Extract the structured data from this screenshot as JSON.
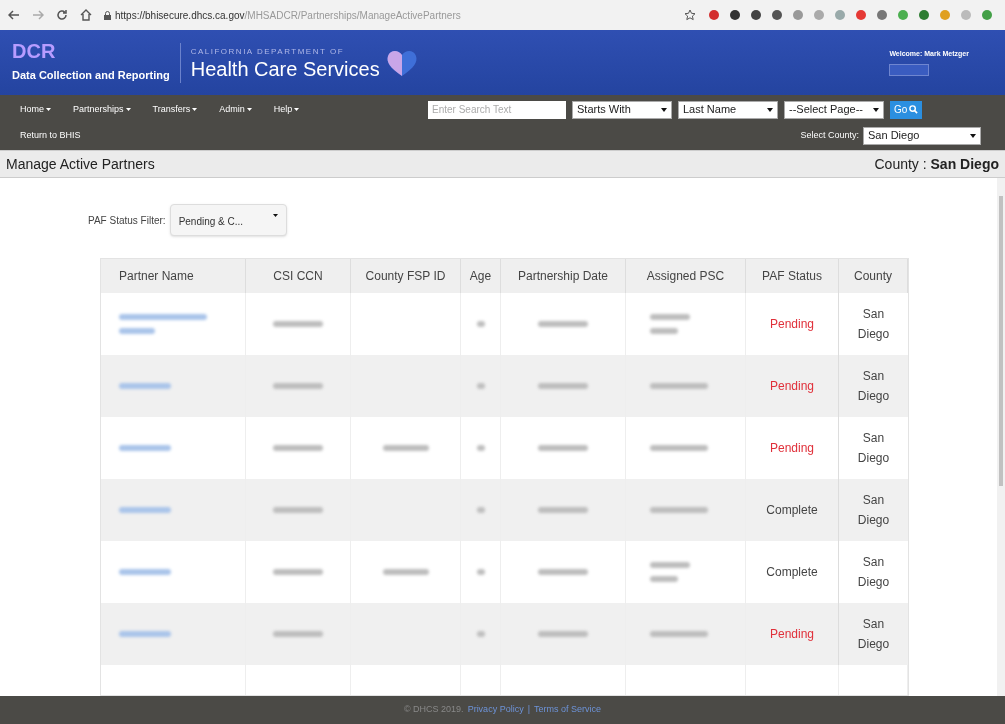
{
  "browser": {
    "url_host": "https://bhisecure.dhcs.ca.gov",
    "url_path": "/MHSADCR/Partnerships/ManageActivePartners"
  },
  "header": {
    "logo": "DCR",
    "subtitle": "Data Collection and Reporting",
    "agency_top": "CALIFORNIA DEPARTMENT OF",
    "agency": "Health Care Services",
    "welcome": "Welcome: Mark Metzger"
  },
  "nav": {
    "items": [
      "Home",
      "Partnerships",
      "Transfers",
      "Admin",
      "Help"
    ],
    "search_placeholder": "Enter Search Text",
    "match": "Starts With",
    "field": "Last Name",
    "page": "--Select Page--",
    "go": "Go",
    "return_link": "Return to BHIS",
    "county_label": "Select County:",
    "county": "San Diego"
  },
  "title_bar": {
    "title": "Manage Active Partners",
    "county_label": "County :",
    "county": "San Diego"
  },
  "filter": {
    "label": "PAF Status Filter:",
    "value": "Pending & C..."
  },
  "table": {
    "columns": [
      "Partner Name",
      "CSI CCN",
      "County FSP ID",
      "Age",
      "Partnership Date",
      "Assigned PSC",
      "PAF Status",
      "County"
    ],
    "rows": [
      {
        "name_wrapped": true,
        "fsp_id_shown": false,
        "psc_wrapped": true,
        "status": "Pending",
        "status_alert": true,
        "county": "San Diego"
      },
      {
        "name_wrapped": false,
        "fsp_id_shown": false,
        "psc_wrapped": false,
        "status": "Pending",
        "status_alert": true,
        "county": "San Diego"
      },
      {
        "name_wrapped": false,
        "fsp_id_shown": true,
        "psc_wrapped": false,
        "status": "Pending",
        "status_alert": true,
        "county": "San Diego"
      },
      {
        "name_wrapped": false,
        "fsp_id_shown": false,
        "psc_wrapped": false,
        "status": "Complete",
        "status_alert": false,
        "county": "San Diego"
      },
      {
        "name_wrapped": false,
        "fsp_id_shown": true,
        "psc_wrapped": true,
        "status": "Complete",
        "status_alert": false,
        "county": "San Diego"
      },
      {
        "name_wrapped": false,
        "fsp_id_shown": false,
        "psc_wrapped": false,
        "status": "Pending",
        "status_alert": true,
        "county": "San Diego"
      }
    ]
  },
  "footer": {
    "copyright": "© DHCS 2019.",
    "privacy": "Privacy Policy",
    "separator": "|",
    "terms": "Terms of Service"
  }
}
